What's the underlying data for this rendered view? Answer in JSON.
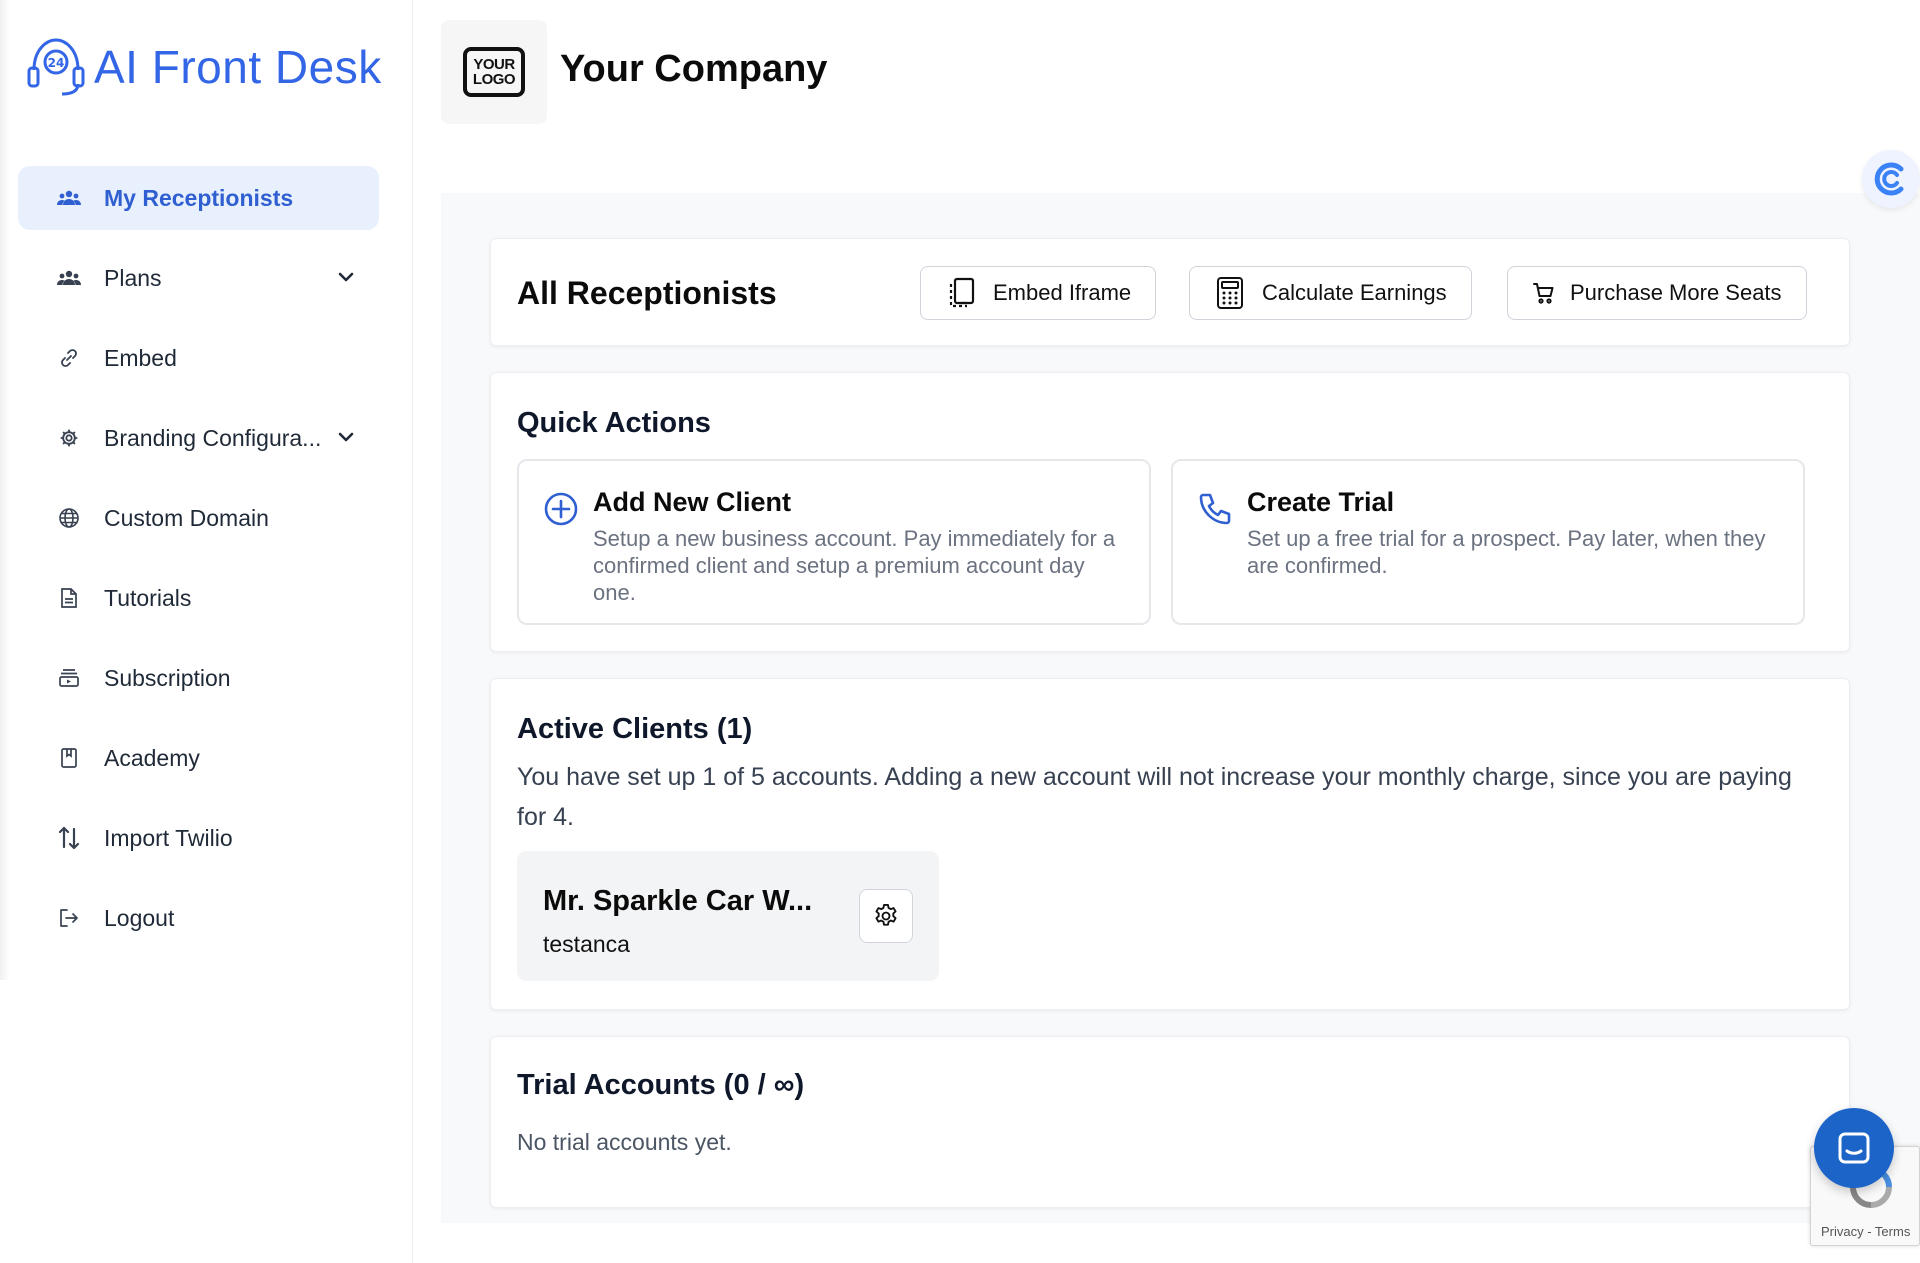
{
  "app": {
    "brand": "AI Front Desk",
    "company_name": "Your Company",
    "logo_text_line1": "YOUR",
    "logo_text_line2": "LOGO",
    "accent_color": "#3366e6"
  },
  "sidebar": {
    "items": [
      {
        "label": "My Receptionists",
        "icon": "users-icon",
        "active": true
      },
      {
        "label": "Plans",
        "icon": "users-icon",
        "has_dropdown": true
      },
      {
        "label": "Embed",
        "icon": "link-icon"
      },
      {
        "label": "Branding Configura...",
        "icon": "gear-icon",
        "has_dropdown": true
      },
      {
        "label": "Custom Domain",
        "icon": "globe-icon"
      },
      {
        "label": "Tutorials",
        "icon": "document-icon"
      },
      {
        "label": "Subscription",
        "icon": "subscription-icon"
      },
      {
        "label": "Academy",
        "icon": "book-icon"
      },
      {
        "label": "Import Twilio",
        "icon": "arrows-up-down-icon"
      },
      {
        "label": "Logout",
        "icon": "logout-icon"
      }
    ]
  },
  "header_card": {
    "title": "All Receptionists",
    "buttons": [
      {
        "label": "Embed Iframe",
        "icon": "tablet-icon"
      },
      {
        "label": "Calculate Earnings",
        "icon": "calculator-icon"
      },
      {
        "label": "Purchase More Seats",
        "icon": "cart-icon"
      }
    ]
  },
  "quick_actions": {
    "title": "Quick Actions",
    "tiles": [
      {
        "title": "Add New Client",
        "description": "Setup a new business account. Pay immediately for a confirmed client and setup a premium account day one.",
        "icon": "plus-circle-icon"
      },
      {
        "title": "Create Trial",
        "description": "Set up a free trial for a prospect. Pay later, when they are confirmed.",
        "icon": "phone-icon"
      }
    ]
  },
  "active_clients": {
    "title": "Active Clients (1)",
    "description": "You have set up 1 of 5 accounts. Adding a new account will not increase your monthly charge, since you are paying for 4.",
    "clients": [
      {
        "name": "Mr. Sparkle Car W...",
        "username": "testanca"
      }
    ]
  },
  "trial_accounts": {
    "title": "Trial Accounts (0 / ∞)",
    "empty_text": "No trial accounts yet."
  },
  "recaptcha": {
    "text": "Privacy - Terms"
  }
}
